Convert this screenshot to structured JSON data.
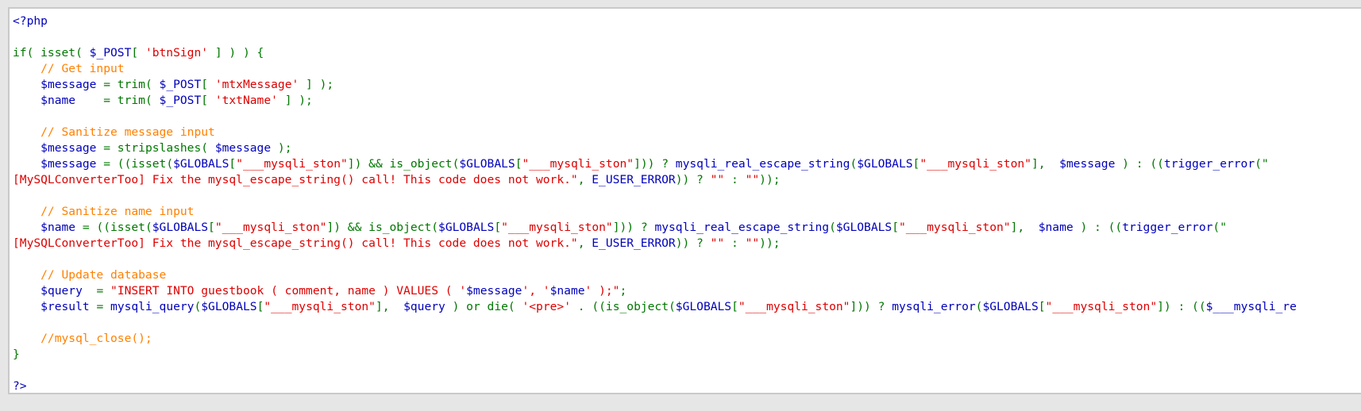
{
  "code_lines": [
    [
      {
        "t": "<?php",
        "c": "kw"
      }
    ],
    [],
    [
      {
        "t": "if( isset( ",
        "c": "df"
      },
      {
        "t": "$_POST",
        "c": "va"
      },
      {
        "t": "[ ",
        "c": "df"
      },
      {
        "t": "'btnSign'",
        "c": "st"
      },
      {
        "t": " ] ) ) {",
        "c": "df"
      }
    ],
    [
      {
        "t": "    // Get input",
        "c": "cm"
      }
    ],
    [
      {
        "t": "    ",
        "c": "df"
      },
      {
        "t": "$message",
        "c": "va"
      },
      {
        "t": " = trim( ",
        "c": "df"
      },
      {
        "t": "$_POST",
        "c": "va"
      },
      {
        "t": "[ ",
        "c": "df"
      },
      {
        "t": "'mtxMessage'",
        "c": "st"
      },
      {
        "t": " ] );",
        "c": "df"
      }
    ],
    [
      {
        "t": "    ",
        "c": "df"
      },
      {
        "t": "$name",
        "c": "va"
      },
      {
        "t": "    = trim( ",
        "c": "df"
      },
      {
        "t": "$_POST",
        "c": "va"
      },
      {
        "t": "[ ",
        "c": "df"
      },
      {
        "t": "'txtName'",
        "c": "st"
      },
      {
        "t": " ] );",
        "c": "df"
      }
    ],
    [],
    [
      {
        "t": "    // Sanitize message input",
        "c": "cm"
      }
    ],
    [
      {
        "t": "    ",
        "c": "df"
      },
      {
        "t": "$message",
        "c": "va"
      },
      {
        "t": " = stripslashes( ",
        "c": "df"
      },
      {
        "t": "$message",
        "c": "va"
      },
      {
        "t": " );",
        "c": "df"
      }
    ],
    [
      {
        "t": "    ",
        "c": "df"
      },
      {
        "t": "$message",
        "c": "va"
      },
      {
        "t": " = ((isset(",
        "c": "df"
      },
      {
        "t": "$GLOBALS",
        "c": "va"
      },
      {
        "t": "[",
        "c": "df"
      },
      {
        "t": "\"___mysqli_ston\"",
        "c": "st"
      },
      {
        "t": "]) && is_object(",
        "c": "df"
      },
      {
        "t": "$GLOBALS",
        "c": "va"
      },
      {
        "t": "[",
        "c": "df"
      },
      {
        "t": "\"___mysqli_ston\"",
        "c": "st"
      },
      {
        "t": "])) ? ",
        "c": "df"
      },
      {
        "t": "mysqli_real_escape_string",
        "c": "va"
      },
      {
        "t": "(",
        "c": "df"
      },
      {
        "t": "$GLOBALS",
        "c": "va"
      },
      {
        "t": "[",
        "c": "df"
      },
      {
        "t": "\"___mysqli_ston\"",
        "c": "st"
      },
      {
        "t": "],  ",
        "c": "df"
      },
      {
        "t": "$message",
        "c": "va"
      },
      {
        "t": " ) : ((",
        "c": "df"
      },
      {
        "t": "trigger_error",
        "c": "va"
      },
      {
        "t": "(\"",
        "c": "df"
      }
    ],
    [
      {
        "t": "[MySQLConverterToo] Fix the mysql_escape_string() call! This code does not work.\"",
        "c": "st"
      },
      {
        "t": ", ",
        "c": "df"
      },
      {
        "t": "E_USER_ERROR",
        "c": "va"
      },
      {
        "t": ")) ? ",
        "c": "df"
      },
      {
        "t": "\"\"",
        "c": "st"
      },
      {
        "t": " : ",
        "c": "df"
      },
      {
        "t": "\"\"",
        "c": "st"
      },
      {
        "t": "));",
        "c": "df"
      }
    ],
    [],
    [
      {
        "t": "    // Sanitize name input",
        "c": "cm"
      }
    ],
    [
      {
        "t": "    ",
        "c": "df"
      },
      {
        "t": "$name",
        "c": "va"
      },
      {
        "t": " = ((isset(",
        "c": "df"
      },
      {
        "t": "$GLOBALS",
        "c": "va"
      },
      {
        "t": "[",
        "c": "df"
      },
      {
        "t": "\"___mysqli_ston\"",
        "c": "st"
      },
      {
        "t": "]) && is_object(",
        "c": "df"
      },
      {
        "t": "$GLOBALS",
        "c": "va"
      },
      {
        "t": "[",
        "c": "df"
      },
      {
        "t": "\"___mysqli_ston\"",
        "c": "st"
      },
      {
        "t": "])) ? ",
        "c": "df"
      },
      {
        "t": "mysqli_real_escape_string",
        "c": "va"
      },
      {
        "t": "(",
        "c": "df"
      },
      {
        "t": "$GLOBALS",
        "c": "va"
      },
      {
        "t": "[",
        "c": "df"
      },
      {
        "t": "\"___mysqli_ston\"",
        "c": "st"
      },
      {
        "t": "],  ",
        "c": "df"
      },
      {
        "t": "$name",
        "c": "va"
      },
      {
        "t": " ) : ((",
        "c": "df"
      },
      {
        "t": "trigger_error",
        "c": "va"
      },
      {
        "t": "(\"",
        "c": "df"
      }
    ],
    [
      {
        "t": "[MySQLConverterToo] Fix the mysql_escape_string() call! This code does not work.\"",
        "c": "st"
      },
      {
        "t": ", ",
        "c": "df"
      },
      {
        "t": "E_USER_ERROR",
        "c": "va"
      },
      {
        "t": ")) ? ",
        "c": "df"
      },
      {
        "t": "\"\"",
        "c": "st"
      },
      {
        "t": " : ",
        "c": "df"
      },
      {
        "t": "\"\"",
        "c": "st"
      },
      {
        "t": "));",
        "c": "df"
      }
    ],
    [],
    [
      {
        "t": "    // Update database",
        "c": "cm"
      }
    ],
    [
      {
        "t": "    ",
        "c": "df"
      },
      {
        "t": "$query",
        "c": "va"
      },
      {
        "t": "  = ",
        "c": "df"
      },
      {
        "t": "\"INSERT INTO guestbook ( comment, name ) VALUES ( '",
        "c": "st"
      },
      {
        "t": "$message",
        "c": "va"
      },
      {
        "t": "', '",
        "c": "st"
      },
      {
        "t": "$name",
        "c": "va"
      },
      {
        "t": "' );\"",
        "c": "st"
      },
      {
        "t": ";",
        "c": "df"
      }
    ],
    [
      {
        "t": "    ",
        "c": "df"
      },
      {
        "t": "$result",
        "c": "va"
      },
      {
        "t": " = ",
        "c": "df"
      },
      {
        "t": "mysqli_query",
        "c": "va"
      },
      {
        "t": "(",
        "c": "df"
      },
      {
        "t": "$GLOBALS",
        "c": "va"
      },
      {
        "t": "[",
        "c": "df"
      },
      {
        "t": "\"___mysqli_ston\"",
        "c": "st"
      },
      {
        "t": "],  ",
        "c": "df"
      },
      {
        "t": "$query",
        "c": "va"
      },
      {
        "t": " ) or die( ",
        "c": "df"
      },
      {
        "t": "'<pre>'",
        "c": "st"
      },
      {
        "t": " . ((is_object(",
        "c": "df"
      },
      {
        "t": "$GLOBALS",
        "c": "va"
      },
      {
        "t": "[",
        "c": "df"
      },
      {
        "t": "\"___mysqli_ston\"",
        "c": "st"
      },
      {
        "t": "])) ? ",
        "c": "df"
      },
      {
        "t": "mysqli_error",
        "c": "va"
      },
      {
        "t": "(",
        "c": "df"
      },
      {
        "t": "$GLOBALS",
        "c": "va"
      },
      {
        "t": "[",
        "c": "df"
      },
      {
        "t": "\"___mysqli_ston\"",
        "c": "st"
      },
      {
        "t": "]) : ((",
        "c": "df"
      },
      {
        "t": "$___mysqli_re",
        "c": "va"
      }
    ],
    [],
    [
      {
        "t": "    //mysql_close();",
        "c": "cm"
      }
    ],
    [
      {
        "t": "}",
        "c": "df"
      }
    ],
    [],
    [
      {
        "t": "?>",
        "c": "kw"
      }
    ]
  ],
  "colors": {
    "keyword": "#0000bb",
    "default": "#007700",
    "string": "#dd0000",
    "comment": "#ff8000",
    "background": "#ffffff"
  }
}
